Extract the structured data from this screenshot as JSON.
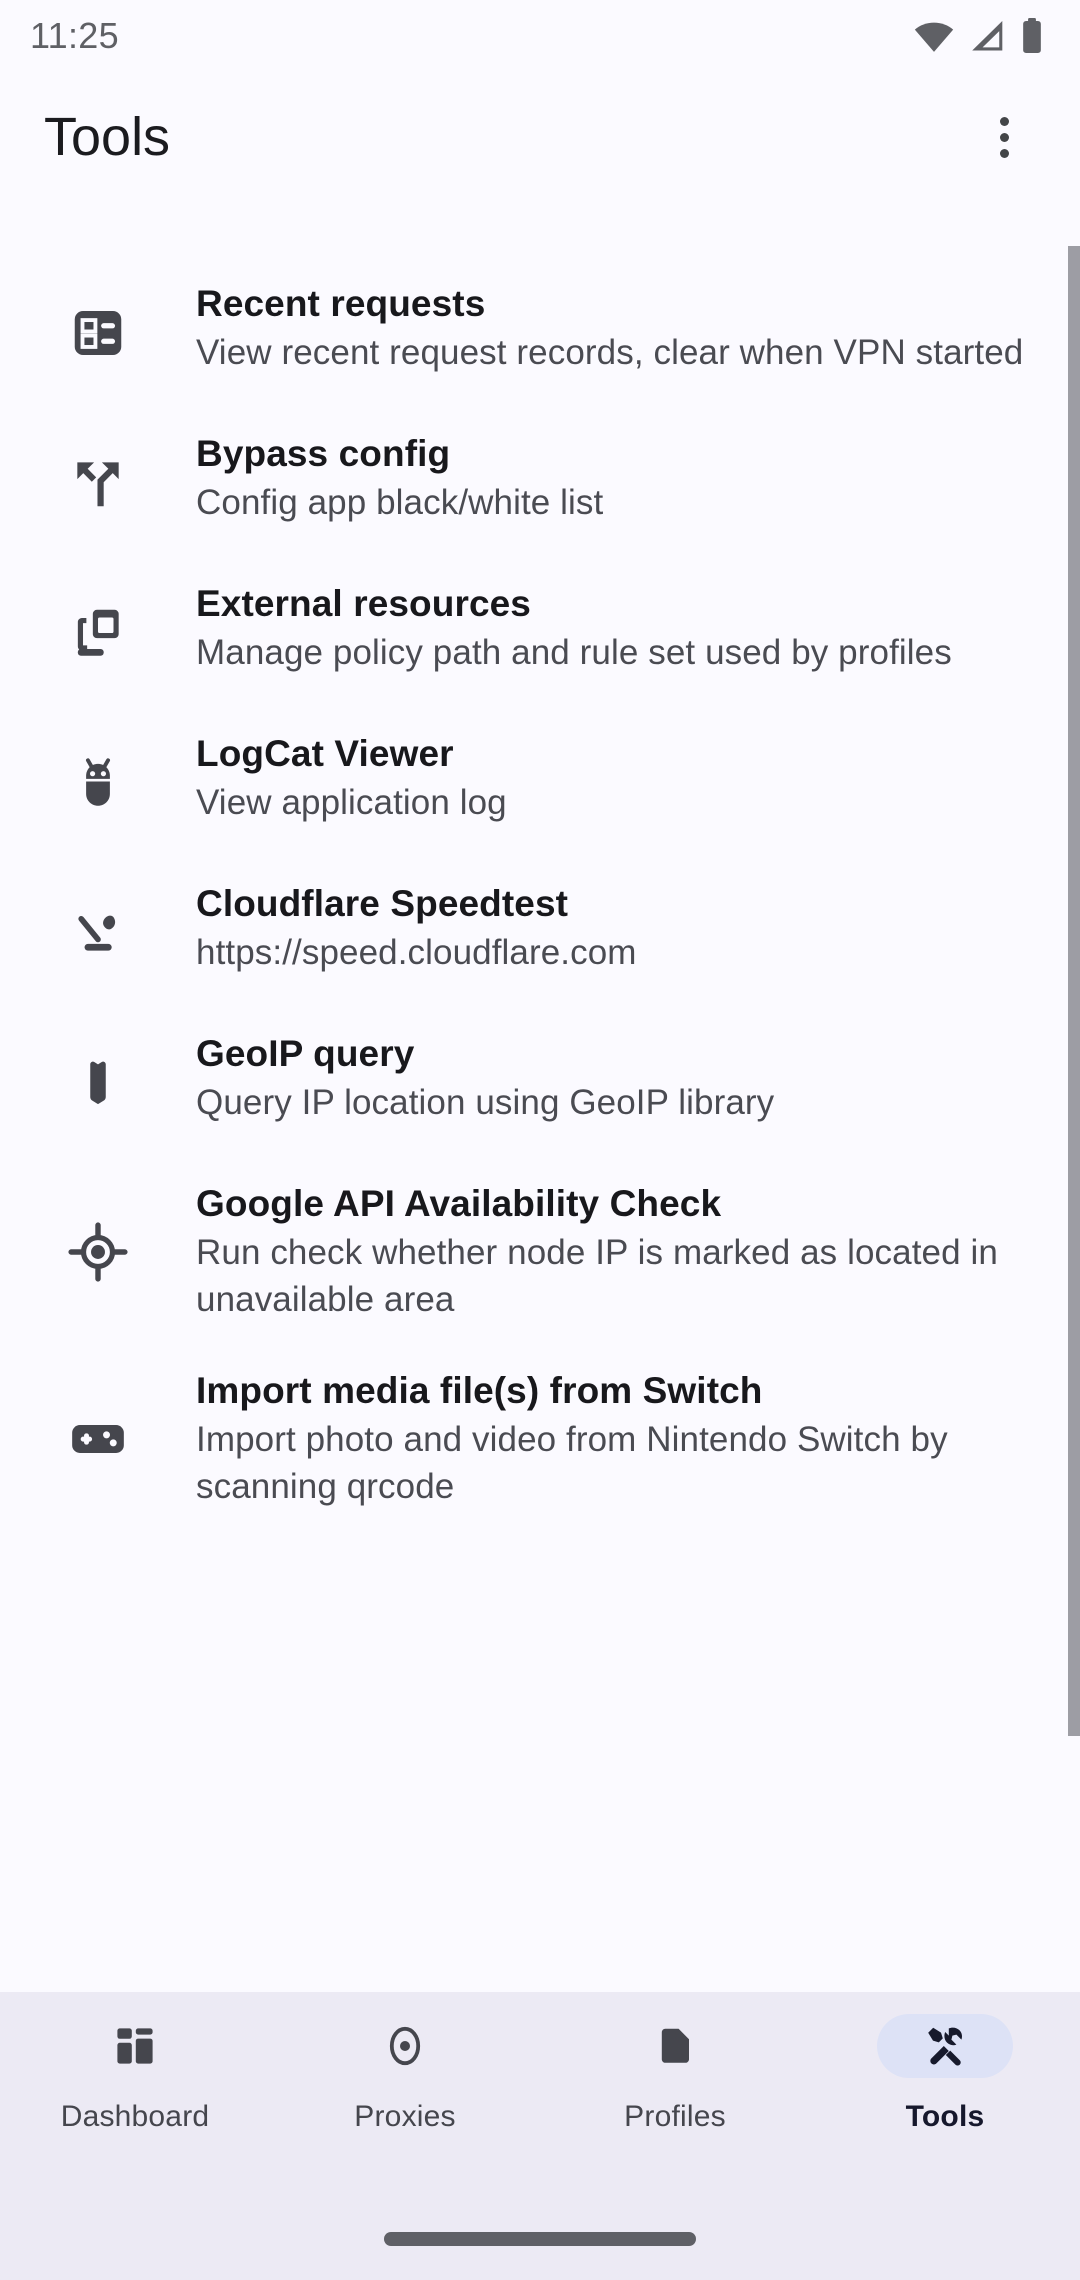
{
  "status_bar": {
    "time": "11:25",
    "icons": [
      "wifi-icon",
      "cellular-signal-icon",
      "battery-icon"
    ]
  },
  "app_bar": {
    "title": "Tools",
    "overflow_menu": "more-options"
  },
  "tools_list": [
    {
      "icon": "ballot-list-icon",
      "title": "Recent requests",
      "subtitle": "View recent request records, clear when VPN started"
    },
    {
      "icon": "call-split-icon",
      "title": "Bypass config",
      "subtitle": "Config app black/white list"
    },
    {
      "icon": "layers-stack-icon",
      "title": "External resources",
      "subtitle": "Manage policy path and rule set used by profiles"
    },
    {
      "icon": "bug-android-icon",
      "title": "LogCat Viewer",
      "subtitle": "View application log"
    },
    {
      "icon": "speed-download-icon",
      "title": "Cloudflare Speedtest",
      "subtitle": "https://speed.cloudflare.com"
    },
    {
      "icon": "map-icon",
      "title": "GeoIP query",
      "subtitle": "Query IP location using GeoIP library"
    },
    {
      "icon": "gps-crosshair-icon",
      "title": "Google API Availability Check",
      "subtitle": "Run check whether node IP is marked as located in unavailable area"
    },
    {
      "icon": "gamepad-icon",
      "title": "Import media file(s) from Switch",
      "subtitle": "Import photo and video from Nintendo Switch by scanning qrcode"
    }
  ],
  "bottom_nav": {
    "items": [
      {
        "icon": "dashboard-icon",
        "label": "Dashboard",
        "active": false
      },
      {
        "icon": "proxies-target-icon",
        "label": "Proxies",
        "active": false
      },
      {
        "icon": "folder-icon",
        "label": "Profiles",
        "active": false
      },
      {
        "icon": "tools-hammer-wrench-icon",
        "label": "Tools",
        "active": true
      }
    ]
  },
  "colors": {
    "page_background": "#fbfaff",
    "nav_background": "#eceaf4",
    "active_pill": "#dde2f6",
    "active_icon": "#171a2c",
    "icon": "#45464d",
    "title_text": "#18181c",
    "subtitle_text": "#4a4b52",
    "scrollbar": "#9d9da4"
  }
}
